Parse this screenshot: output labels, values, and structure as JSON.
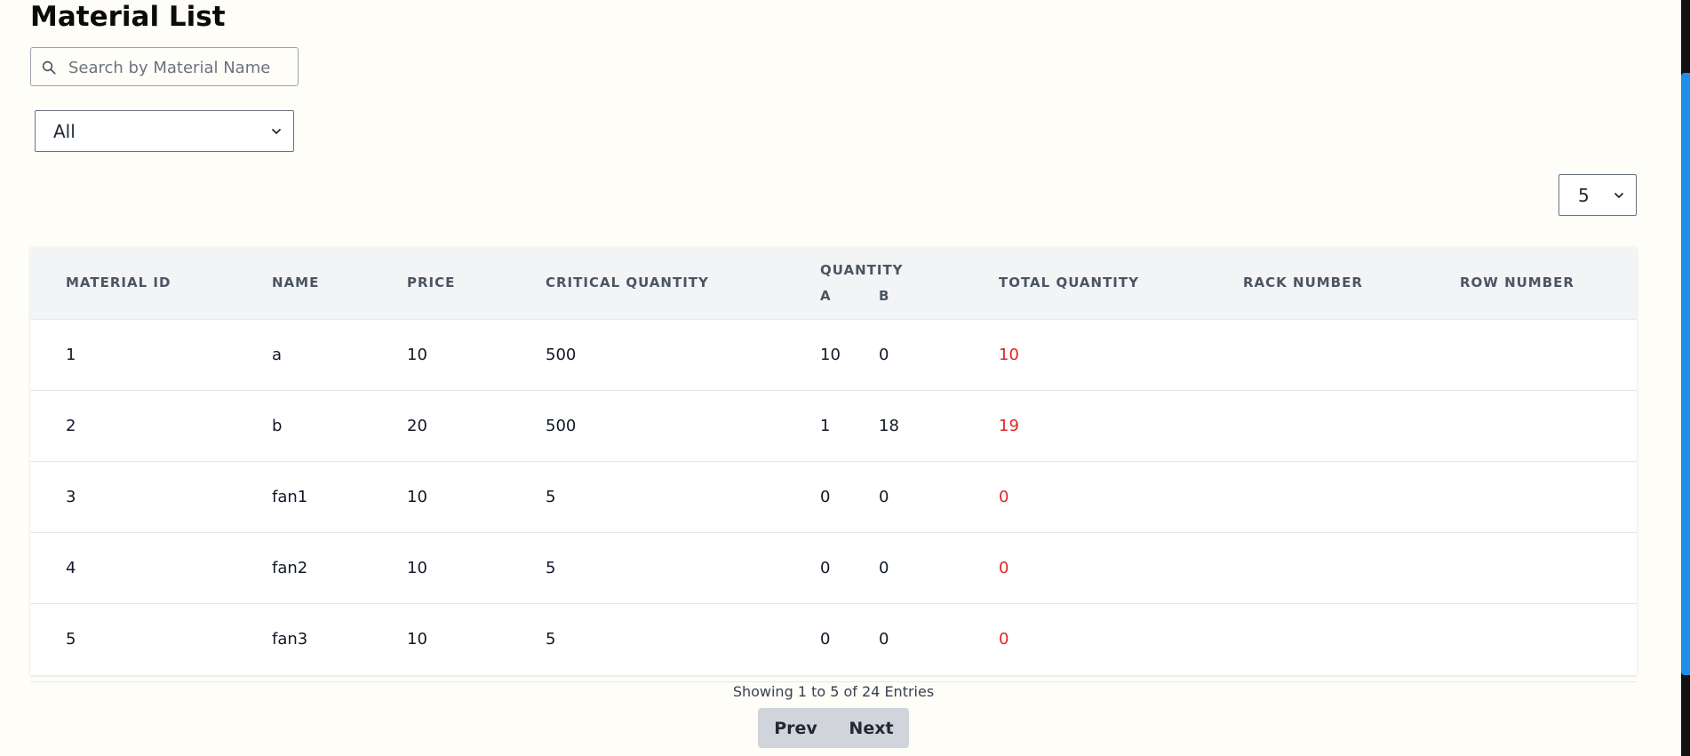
{
  "page": {
    "title": "Material List"
  },
  "search": {
    "placeholder": "Search by Material Name",
    "value": ""
  },
  "filter": {
    "selected": "All"
  },
  "page_size": {
    "selected": "5"
  },
  "table": {
    "headers": {
      "material_id": "MATERIAL ID",
      "name": "NAME",
      "price": "PRICE",
      "critical_quantity": "CRITICAL QUANTITY",
      "quantity": "QUANTITY",
      "quantity_a": "A",
      "quantity_b": "B",
      "total_quantity": "TOTAL QUANTITY",
      "rack_number": "RACK NUMBER",
      "row_number": "ROW NUMBER"
    },
    "rows": [
      {
        "id": "1",
        "name": "a",
        "price": "10",
        "critical": "500",
        "qa": "10",
        "qb": "0",
        "total": "10",
        "rack": "",
        "row": ""
      },
      {
        "id": "2",
        "name": "b",
        "price": "20",
        "critical": "500",
        "qa": "1",
        "qb": "18",
        "total": "19",
        "rack": "",
        "row": ""
      },
      {
        "id": "3",
        "name": "fan1",
        "price": "10",
        "critical": "5",
        "qa": "0",
        "qb": "0",
        "total": "0",
        "rack": "",
        "row": ""
      },
      {
        "id": "4",
        "name": "fan2",
        "price": "10",
        "critical": "5",
        "qa": "0",
        "qb": "0",
        "total": "0",
        "rack": "",
        "row": ""
      },
      {
        "id": "5",
        "name": "fan3",
        "price": "10",
        "critical": "5",
        "qa": "0",
        "qb": "0",
        "total": "0",
        "rack": "",
        "row": ""
      }
    ]
  },
  "pagination": {
    "showing": "Showing 1 to 5 of 24 Entries",
    "prev_label": "Prev",
    "next_label": "Next"
  },
  "colors": {
    "total_below_critical": "#dc2626",
    "scrollbar_thumb": "#1d8fe6"
  },
  "icons": {
    "search": "search-icon",
    "dropdown": "chevron-down-icon"
  }
}
